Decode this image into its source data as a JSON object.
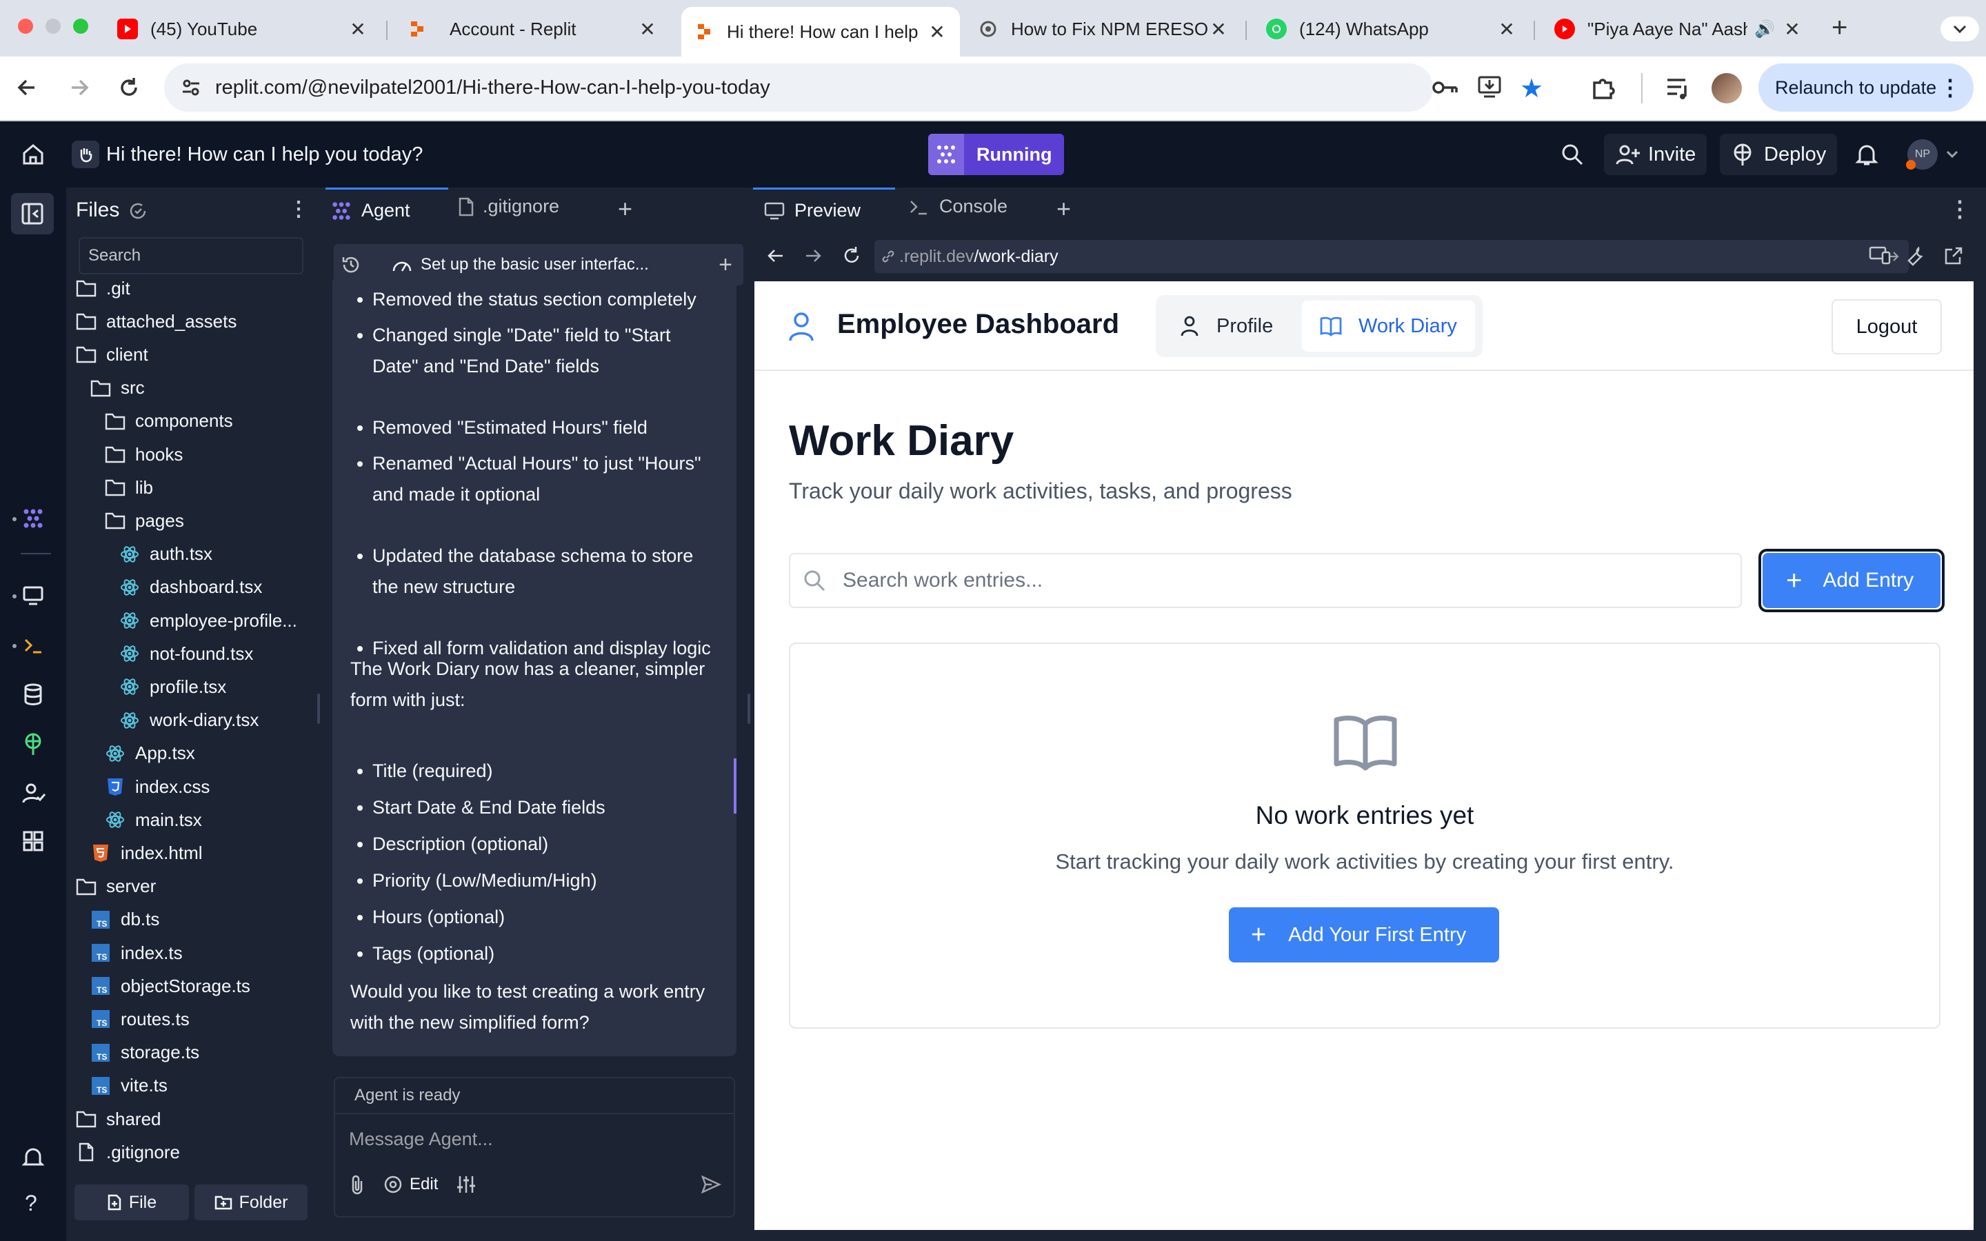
{
  "browser": {
    "tabs": [
      {
        "title": "(45) YouTube",
        "icon": "youtube-icon"
      },
      {
        "title": "Account - Replit",
        "icon": "replit-icon"
      },
      {
        "title": "Hi there! How can I help",
        "icon": "replit-icon",
        "active": true
      },
      {
        "title": "How to Fix NPM ERESOLVE",
        "icon": "web-icon"
      },
      {
        "title": "(124) WhatsApp",
        "icon": "whatsapp-icon"
      },
      {
        "title": "\"Piya Aaye Na\" Aashiqui",
        "icon": "youtube-music-icon"
      }
    ],
    "url_domain": "replit.com",
    "url_path": "/@nevilpatel2001/Hi-there-How-can-I-help-you-today",
    "relaunch_label": "Relaunch to update"
  },
  "replit": {
    "repl_title": "Hi there! How can I help you today?",
    "run_status": "Running",
    "invite_label": "Invite",
    "deploy_label": "Deploy",
    "avatar_initials": "NP",
    "files": {
      "title": "Files",
      "search_placeholder": "Search",
      "items": [
        {
          "name": ".git",
          "type": "folder",
          "depth": 0
        },
        {
          "name": "attached_assets",
          "type": "folder",
          "depth": 0
        },
        {
          "name": "client",
          "type": "folder",
          "depth": 0
        },
        {
          "name": "src",
          "type": "folder",
          "depth": 1
        },
        {
          "name": "components",
          "type": "folder",
          "depth": 2
        },
        {
          "name": "hooks",
          "type": "folder",
          "depth": 2
        },
        {
          "name": "lib",
          "type": "folder",
          "depth": 2
        },
        {
          "name": "pages",
          "type": "folder",
          "depth": 2
        },
        {
          "name": "auth.tsx",
          "type": "react",
          "depth": 3
        },
        {
          "name": "dashboard.tsx",
          "type": "react",
          "depth": 3
        },
        {
          "name": "employee-profile...",
          "type": "react",
          "depth": 3
        },
        {
          "name": "not-found.tsx",
          "type": "react",
          "depth": 3
        },
        {
          "name": "profile.tsx",
          "type": "react",
          "depth": 3
        },
        {
          "name": "work-diary.tsx",
          "type": "react",
          "depth": 3
        },
        {
          "name": "App.tsx",
          "type": "react",
          "depth": 2
        },
        {
          "name": "index.css",
          "type": "css",
          "depth": 2
        },
        {
          "name": "main.tsx",
          "type": "react",
          "depth": 2
        },
        {
          "name": "index.html",
          "type": "html",
          "depth": 1
        },
        {
          "name": "server",
          "type": "folder",
          "depth": 0
        },
        {
          "name": "db.ts",
          "type": "ts",
          "depth": 1
        },
        {
          "name": "index.ts",
          "type": "ts",
          "depth": 1
        },
        {
          "name": "objectStorage.ts",
          "type": "ts",
          "depth": 1
        },
        {
          "name": "routes.ts",
          "type": "ts",
          "depth": 1
        },
        {
          "name": "storage.ts",
          "type": "ts",
          "depth": 1
        },
        {
          "name": "vite.ts",
          "type": "ts",
          "depth": 1
        },
        {
          "name": "shared",
          "type": "folder",
          "depth": 0
        },
        {
          "name": ".gitignore",
          "type": "file",
          "depth": 0
        }
      ],
      "new_file_label": "File",
      "new_folder_label": "Folder"
    },
    "editor_tabs": {
      "agent": "Agent",
      "gitignore": ".gitignore"
    },
    "agent": {
      "task_title": "Set up the basic user interfac...",
      "bullets_1": [
        "Removed the status section completely",
        "Changed single \"Date\" field to \"Start Date\" and \"End Date\" fields",
        "Removed \"Estimated Hours\" field",
        "Renamed \"Actual Hours\" to just \"Hours\" and made it optional",
        "Updated the database schema to store the new structure",
        "Fixed all form validation and display logic"
      ],
      "summary": "The Work Diary now has a cleaner, simpler form with just:",
      "bullets_2": [
        "Title (required)",
        "Start Date & End Date fields",
        "Description (optional)",
        "Priority (Low/Medium/High)",
        "Hours (optional)",
        "Tags (optional)"
      ],
      "question": "Would you like to test creating a work entry with the new simplified form?",
      "status": "Agent is ready",
      "input_placeholder": "Message Agent...",
      "edit_label": "Edit"
    },
    "preview_tabs": {
      "preview": "Preview",
      "console": "Console"
    },
    "webview_url_prefix": ".replit.dev",
    "webview_url_path": "/work-diary"
  },
  "app": {
    "brand": "Employee Dashboard",
    "nav": {
      "profile": "Profile",
      "work_diary": "Work Diary"
    },
    "logout": "Logout",
    "page_title": "Work Diary",
    "page_subtitle": "Track your daily work activities, tasks, and progress",
    "search_placeholder": "Search work entries...",
    "add_entry": "Add Entry",
    "empty_title": "No work entries yet",
    "empty_text": "Start tracking your daily work activities by creating your first entry.",
    "add_first": "Add Your First Entry"
  },
  "colors": {
    "replit_bg": "#0e1525",
    "panel_bg": "#1c2333",
    "accent_blue": "#3b82f6",
    "running_purple": "#5b3fd3"
  }
}
